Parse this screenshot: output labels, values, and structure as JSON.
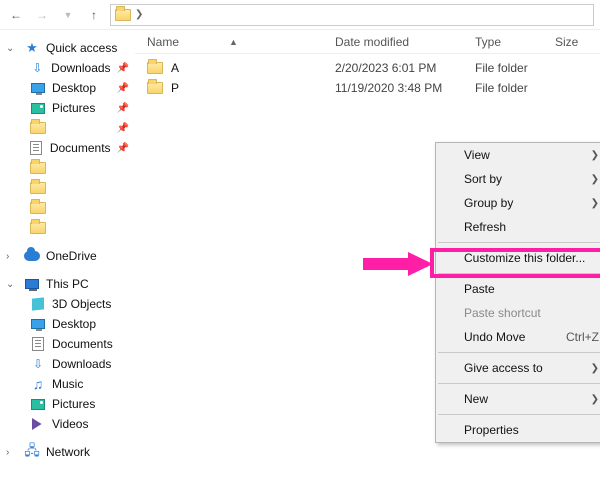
{
  "columns": {
    "name": "Name",
    "date": "Date modified",
    "type": "Type",
    "size": "Size"
  },
  "rows": [
    {
      "name": "A",
      "date": "2/20/2023 6:01 PM",
      "type": "File folder"
    },
    {
      "name": "P",
      "date": "11/19/2020 3:48 PM",
      "type": "File folder"
    }
  ],
  "nav": {
    "quick_access": "Quick access",
    "downloads": "Downloads",
    "desktop": "Desktop",
    "pictures": "Pictures",
    "documents": "Documents",
    "onedrive": "OneDrive",
    "this_pc": "This PC",
    "objects3d": "3D Objects",
    "desktop2": "Desktop",
    "documents2": "Documents",
    "downloads2": "Downloads",
    "music": "Music",
    "pictures2": "Pictures",
    "videos": "Videos",
    "network": "Network"
  },
  "ctx": {
    "view": "View",
    "sort_by": "Sort by",
    "group_by": "Group by",
    "refresh": "Refresh",
    "customize": "Customize this folder...",
    "paste": "Paste",
    "paste_shortcut": "Paste shortcut",
    "undo_move": "Undo Move",
    "undo_key": "Ctrl+Z",
    "give_access": "Give access to",
    "new": "New",
    "properties": "Properties"
  }
}
